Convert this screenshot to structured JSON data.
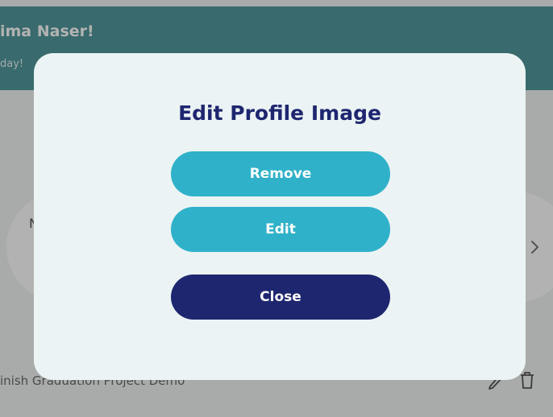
{
  "page": {
    "greeting": "ima Naser!",
    "subgreeting": "day!",
    "card_initial": "N",
    "task_text": "inish Graduation Project Demo"
  },
  "icons": {
    "chevron": "chevron-right-icon",
    "edit": "pencil-icon",
    "trash": "trash-icon"
  },
  "modal": {
    "title": "Edit Profile Image",
    "buttons": {
      "remove": "Remove",
      "edit": "Edit",
      "close": "Close"
    }
  },
  "colors": {
    "header": "#52989c",
    "modal_bg": "#ebf3f4",
    "accent": "#2fb1c9",
    "primary_dark": "#1e2670"
  }
}
